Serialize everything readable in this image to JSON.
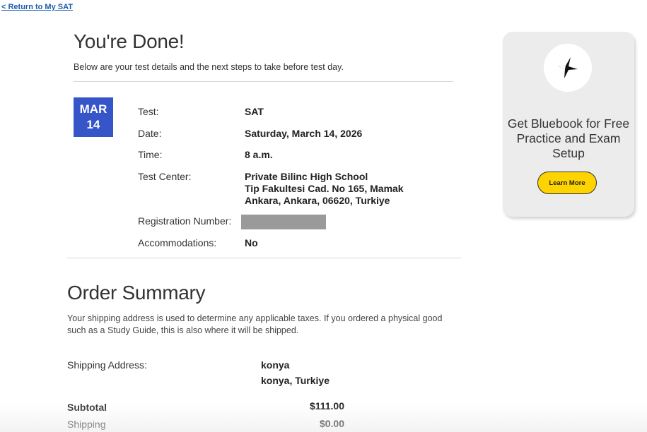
{
  "nav": {
    "return_link": "< Return to My SAT"
  },
  "header": {
    "title": "You're Done!",
    "subtitle": "Below are your test details and the next steps to take before test day."
  },
  "date_badge": {
    "month": "MAR",
    "day": "14"
  },
  "details": {
    "test_label": "Test:",
    "test_value": "SAT",
    "date_label": "Date:",
    "date_value": "Saturday, March 14, 2026",
    "time_label": "Time:",
    "time_value": "8 a.m.",
    "center_label": "Test Center:",
    "center_name": "Private Bilinc High School",
    "center_address1": "Tip Fakultesi Cad. No 165, Mamak",
    "center_address2": "Ankara, Ankara, 06620, Turkiye",
    "registration_label": "Registration Number:",
    "accommodations_label": "Accommodations:",
    "accommodations_value": "No"
  },
  "order": {
    "title": "Order Summary",
    "note": "Your shipping address is used to determine any applicable taxes. If you ordered a physical good such as a Study Guide, this is also where it will be shipped.",
    "shipping_address_label": "Shipping Address:",
    "shipping_line1": "konya",
    "shipping_line2": "konya, Turkiye",
    "subtotal_label": "Subtotal",
    "subtotal_value": "$111.00",
    "shipping_label": "Shipping",
    "shipping_value": "$0.00"
  },
  "promo": {
    "text": "Get Bluebook for Free Practice and Exam Setup",
    "button_label": "Learn More",
    "icon": "bluebook-star-icon"
  },
  "colors": {
    "badge_blue": "#3555c9",
    "button_yellow": "#fdd300",
    "link_blue": "#1a5dad"
  }
}
